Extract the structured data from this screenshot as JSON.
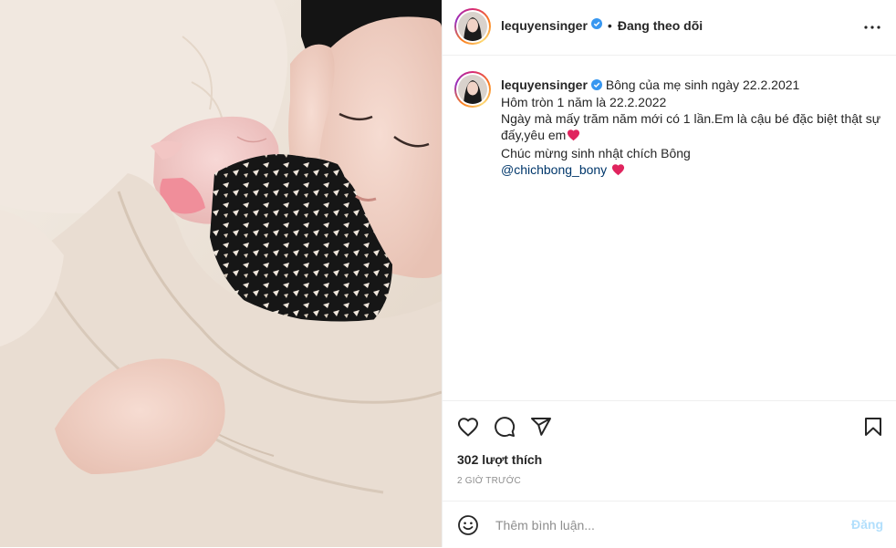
{
  "post": {
    "author": {
      "username": "lequyensinger",
      "verified": true,
      "avatar": "profile-photo"
    },
    "follow_status": "Đang theo dõi",
    "separator": "•",
    "more_icon": "more-options-icon",
    "caption": {
      "username": "lequyensinger",
      "line1": "Bông của mẹ sinh ngày 22.2.2021",
      "line2": "Hôm tròn 1 năm là 22.2.2022",
      "line3": "Ngày mà mấy trăm năm mới có 1 lần.Em là cậu bé đặc biệt thật sự",
      "line4": "đấy,yêu em",
      "line5": "Chúc mừng sinh nhật chích Bông",
      "mention": "@chichbong_bony"
    },
    "actions": {
      "like": "heart-icon",
      "comment": "comment-icon",
      "share": "send-icon",
      "save": "bookmark-icon"
    },
    "likes": "302 lượt thích",
    "time_ago": "2 GIỜ TRƯỚC",
    "comment": {
      "placeholder": "Thêm bình luận...",
      "value": "",
      "post_label": "Đăng",
      "emoji_icon": "emoji-icon"
    },
    "colors": {
      "text": "#262626",
      "link": "#00376b",
      "muted": "#8e8e8e",
      "post_button_disabled": "#b2dffc",
      "verified": "#3897f0",
      "heart": "#e0245e"
    }
  }
}
